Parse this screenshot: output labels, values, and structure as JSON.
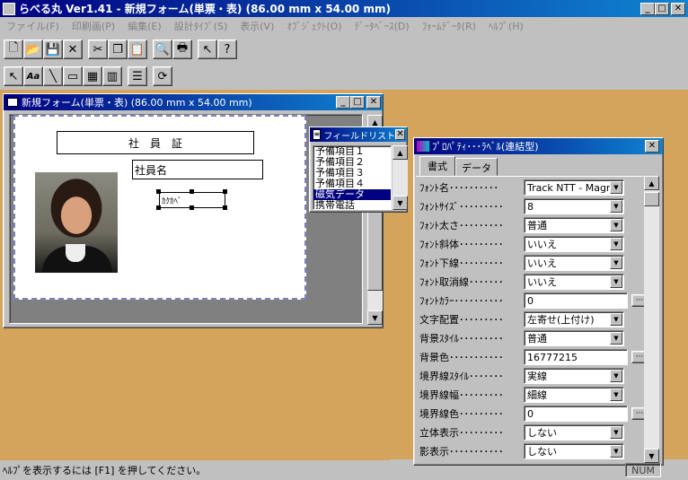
{
  "app": {
    "title": "らべる丸 Ver1.41 - 新規フォーム(単票・表) (86.00 mm x 54.00 mm)"
  },
  "menu": [
    "ファイル(F)",
    "印刷画(P)",
    "編集(E)",
    "設計ﾀｲﾌﾟ(S)",
    "表示(V)",
    "ｵﾌﾞｼﾞｪｸﾄ(O)",
    "ﾃﾞｰﾀﾍﾞｰｽ(D)",
    "ﾌｫｰﾑﾃﾞｰﾀ(R)",
    "ﾍﾙﾌﾟ(H)"
  ],
  "toolbar1": [
    {
      "name": "new-icon",
      "glyph": "🗋"
    },
    {
      "name": "open-folder-icon",
      "glyph": "📂"
    },
    {
      "name": "save-icon",
      "glyph": "💾"
    },
    {
      "name": "delete-icon",
      "glyph": "✕"
    },
    {
      "name": "cut-icon",
      "glyph": "✂"
    },
    {
      "name": "copy-icon",
      "glyph": "❐"
    },
    {
      "name": "paste-icon",
      "glyph": "📋"
    },
    {
      "name": "print-preview-icon",
      "glyph": "🔍"
    },
    {
      "name": "print-icon",
      "glyph": "🖶"
    },
    {
      "name": "pointer-help-icon",
      "glyph": "↖"
    },
    {
      "name": "help-icon",
      "glyph": "?"
    }
  ],
  "toolbar2": [
    {
      "name": "select-tool-icon",
      "glyph": "↖"
    },
    {
      "name": "text-tool-icon",
      "glyph": "Aa"
    },
    {
      "name": "line-tool-icon",
      "glyph": "╲"
    },
    {
      "name": "rectangle-tool-icon",
      "glyph": "▭"
    },
    {
      "name": "image-tool-icon",
      "glyph": "▦"
    },
    {
      "name": "barcode-tool-icon",
      "glyph": "▥"
    },
    {
      "name": "list-tool-icon",
      "glyph": "☰"
    },
    {
      "name": "refresh-icon",
      "glyph": "⟳"
    }
  ],
  "form_window": {
    "title": "新規フォーム(単票・表) (86.00 mm x 54.00 mm)",
    "header_label": "社　員　証",
    "name_field": "社員名",
    "selected_label": "ｶｸｶﾍﾞ"
  },
  "field_list": {
    "title": "フィールドリスト",
    "items": [
      "予備項目１",
      "予備項目２",
      "予備項目３",
      "予備項目４",
      "磁気データ",
      "携帯電話"
    ],
    "selected_index": 4
  },
  "properties": {
    "title": "ﾌﾟﾛﾊﾟﾃｨ･･･ﾗﾍﾞﾙ(連結型)",
    "tabs": [
      "書式",
      "データ"
    ],
    "rows": [
      {
        "label": "ﾌｫﾝﾄ名･･････････",
        "value": "Track NTT - Magr",
        "type": "dropdown"
      },
      {
        "label": "ﾌｫﾝﾄｻｲｽﾞ･････････",
        "value": "8",
        "type": "dropdown"
      },
      {
        "label": "ﾌｫﾝﾄ太さ･････････",
        "value": "普通",
        "type": "dropdown"
      },
      {
        "label": "ﾌｫﾝﾄ斜体･････････",
        "value": "いいえ",
        "type": "dropdown"
      },
      {
        "label": "ﾌｫﾝﾄ下線･････････",
        "value": "いいえ",
        "type": "dropdown"
      },
      {
        "label": "ﾌｫﾝﾄ取消線･･･････",
        "value": "いいえ",
        "type": "dropdown"
      },
      {
        "label": "ﾌｫﾝﾄｶﾗｰ･･････････",
        "value": "0",
        "type": "button"
      },
      {
        "label": "文字配置･････････",
        "value": "左寄せ(上付け)",
        "type": "dropdown"
      },
      {
        "label": "背景ｽﾀｲﾙ･････････",
        "value": "普通",
        "type": "dropdown"
      },
      {
        "label": "背景色･･･････････",
        "value": "16777215",
        "type": "button"
      },
      {
        "label": "境界線ｽﾀｲﾙ･･･････",
        "value": "実線",
        "type": "dropdown"
      },
      {
        "label": "境界線幅･････････",
        "value": "細線",
        "type": "dropdown"
      },
      {
        "label": "境界線色･････････",
        "value": "0",
        "type": "button"
      },
      {
        "label": "立体表示･････････",
        "value": "しない",
        "type": "dropdown"
      },
      {
        "label": "影表示･･･････････",
        "value": "しない",
        "type": "dropdown"
      }
    ]
  },
  "status": {
    "text": "ﾍﾙﾌﾟを表示するには [F1] を押してください。",
    "num": "NUM"
  }
}
